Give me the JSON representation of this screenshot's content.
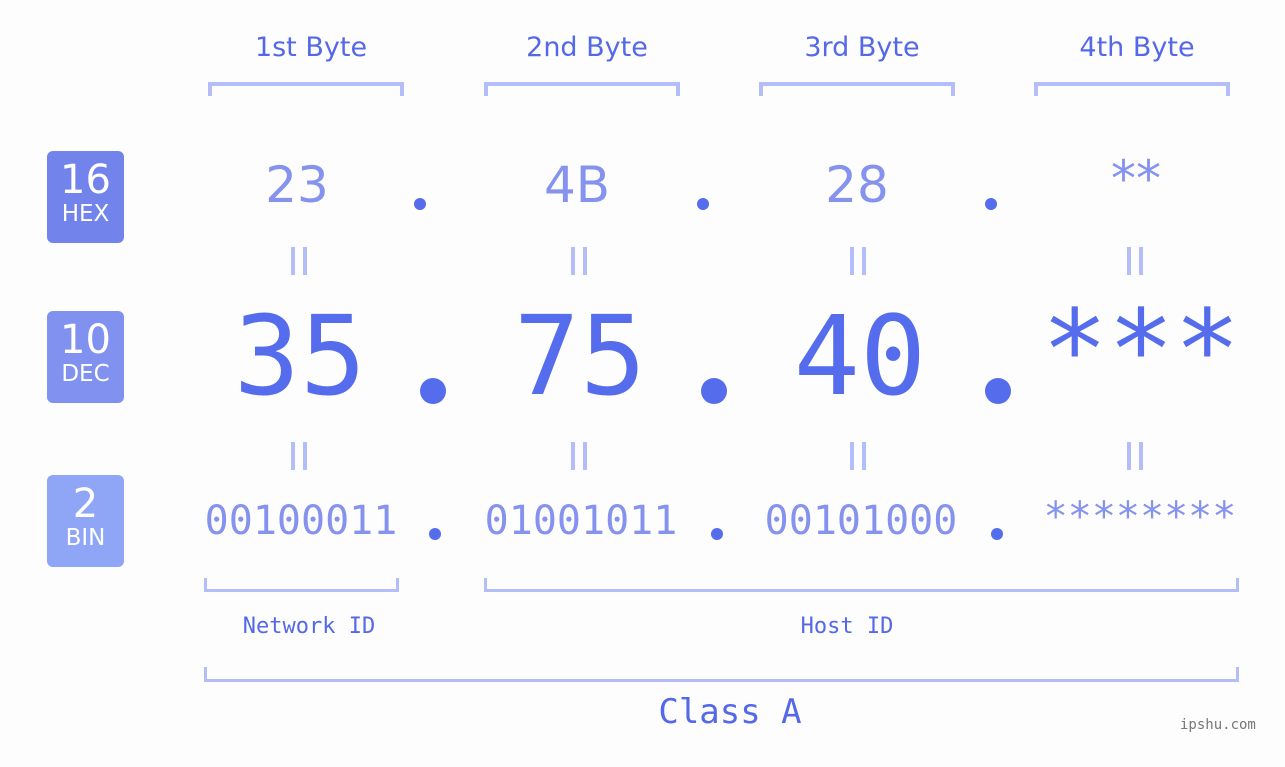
{
  "bytes": [
    {
      "header": "1st Byte",
      "hex": "23",
      "dec": "35",
      "bin": "00100011"
    },
    {
      "header": "2nd Byte",
      "hex": "4B",
      "dec": "75",
      "bin": "01001011"
    },
    {
      "header": "3rd Byte",
      "hex": "28",
      "dec": "40",
      "bin": "00101000"
    },
    {
      "header": "4th Byte",
      "hex": "**",
      "dec": "***",
      "bin": "********"
    }
  ],
  "badges": {
    "hex": {
      "num": "16",
      "label": "HEX",
      "color": "#7283ec"
    },
    "dec": {
      "num": "10",
      "label": "DEC",
      "color": "#8191f0"
    },
    "bin": {
      "num": "2",
      "label": "BIN",
      "color": "#8fa5f6"
    }
  },
  "separator": ".",
  "network_id_label": "Network ID",
  "host_id_label": "Host ID",
  "class_label": "Class A",
  "watermark": "ipshu.com",
  "colors": {
    "accent": "#556ced",
    "light": "#8592ee",
    "bracket": "#b3bdf8"
  }
}
